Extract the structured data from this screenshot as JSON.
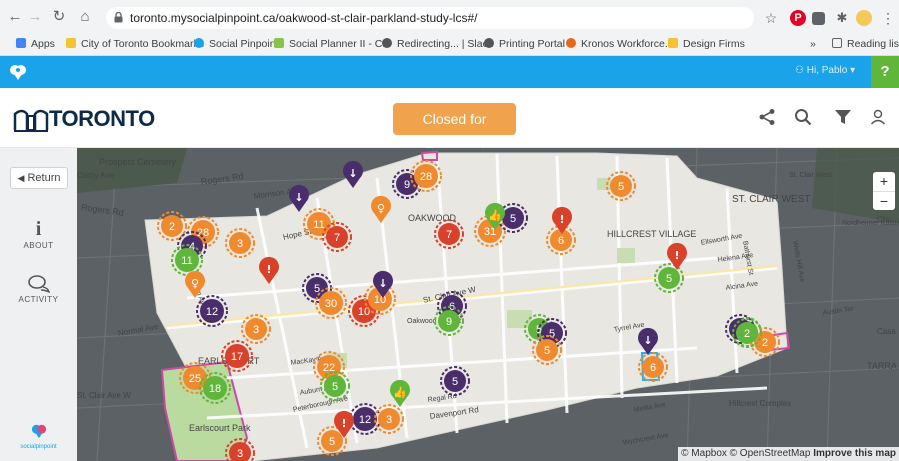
{
  "browser": {
    "url": "toronto.mysocialpinpoint.ca/oakwood-st-clair-parkland-study-lcs#/",
    "bookmarks": [
      "Apps",
      "City of Toronto Bookmarks",
      "Social Pinpoint",
      "Social Planner II - C...",
      "Redirecting... | Slack",
      "Printing Portal",
      "Kronos Workforce...",
      "Design Firms"
    ],
    "more": "»",
    "reading_list": "Reading list"
  },
  "app": {
    "user_greeting": "Hi, Pablo",
    "help": "?",
    "status_button": "Closed for Comment",
    "logo_text": "TORONTO",
    "brand_small": "socialpinpoint"
  },
  "sidebar": {
    "return_label": "Return",
    "about_label": "ABOUT",
    "activity_label": "ACTIVITY"
  },
  "map": {
    "attribution": "© Mapbox © OpenStreetMap",
    "improve": "Improve this map",
    "zoom_in": "+",
    "zoom_out": "−",
    "place_labels": [
      {
        "text": "Prospect Cemetery"
      },
      {
        "text": "Corby Ave"
      },
      {
        "text": "Rogers Rd"
      },
      {
        "text": "Morrison Ave"
      },
      {
        "text": "Rogers Rd"
      },
      {
        "text": "OAKWOOD"
      },
      {
        "text": "HILLCREST VILLAGE"
      },
      {
        "text": "ST. CLAIR WEST"
      },
      {
        "text": "St. Clair West"
      },
      {
        "text": "Nordheimer Ravine"
      },
      {
        "text": "Hope St"
      },
      {
        "text": "Ellsworth Ave"
      },
      {
        "text": "Helena Ave"
      },
      {
        "text": "Alcina Ave"
      },
      {
        "text": "Austin Ter"
      },
      {
        "text": "St. Clair Ave W"
      },
      {
        "text": "Normal Ave"
      },
      {
        "text": "EARLSCOURT"
      },
      {
        "text": "MacKay Ave"
      },
      {
        "text": "Tyrrel Ave"
      },
      {
        "text": "Hillcrest Complex"
      },
      {
        "text": "Earlscourt Park"
      },
      {
        "text": "Regal Rd"
      },
      {
        "text": "Davenport Rd"
      },
      {
        "text": "Melita Ave"
      },
      {
        "text": "Wychcrest Ave"
      },
      {
        "text": "Peterborough Ave"
      },
      {
        "text": "Auburn Ave"
      },
      {
        "text": "St. Clair Ave W"
      },
      {
        "text": "Casa"
      },
      {
        "text": "TARRA VILLA"
      },
      {
        "text": "Chu"
      },
      {
        "text": "Oakwood Regent"
      },
      {
        "text": "Gwynn Ave"
      },
      {
        "text": "Wells Hill Ave"
      },
      {
        "text": "Bathurst St"
      }
    ],
    "clusters": [
      {
        "n": "2",
        "c": "orange"
      },
      {
        "n": "28",
        "c": "orange"
      },
      {
        "n": "3",
        "c": "orange"
      },
      {
        "n": "4",
        "c": "purple"
      },
      {
        "n": "11",
        "c": "green"
      },
      {
        "n": "11",
        "c": "orange"
      },
      {
        "n": "7",
        "c": "red"
      },
      {
        "n": "9",
        "c": "purple"
      },
      {
        "n": "28",
        "c": "orange"
      },
      {
        "n": "7",
        "c": "red"
      },
      {
        "n": "31",
        "c": "orange"
      },
      {
        "n": "5",
        "c": "purple"
      },
      {
        "n": "6",
        "c": "orange"
      },
      {
        "n": "5",
        "c": "orange"
      },
      {
        "n": "5",
        "c": "purple"
      },
      {
        "n": "30",
        "c": "orange"
      },
      {
        "n": "10",
        "c": "red"
      },
      {
        "n": "10",
        "c": "orange"
      },
      {
        "n": "12",
        "c": "purple"
      },
      {
        "n": "3",
        "c": "orange"
      },
      {
        "n": "6",
        "c": "purple"
      },
      {
        "n": "9",
        "c": "green"
      },
      {
        "n": "5",
        "c": "green"
      },
      {
        "n": "5",
        "c": "purple"
      },
      {
        "n": "5",
        "c": "orange"
      },
      {
        "n": "5",
        "c": "green"
      },
      {
        "n": "17",
        "c": "red"
      },
      {
        "n": "22",
        "c": "orange"
      },
      {
        "n": "5",
        "c": "green"
      },
      {
        "n": "25",
        "c": "orange"
      },
      {
        "n": "18",
        "c": "green"
      },
      {
        "n": "5",
        "c": "purple"
      },
      {
        "n": "12",
        "c": "purple"
      },
      {
        "n": "3",
        "c": "orange"
      },
      {
        "n": "5",
        "c": "orange"
      },
      {
        "n": "3",
        "c": "red"
      },
      {
        "n": "6",
        "c": "orange"
      },
      {
        "n": "2",
        "c": "green"
      },
      {
        "n": "2",
        "c": "orange"
      },
      {
        "n": "4",
        "c": "purple"
      },
      {
        "n": "2",
        "c": "green"
      }
    ],
    "marker_colors": {
      "orange": "#f08a2e",
      "red": "#d9412b",
      "purple": "#4a2d6b",
      "green": "#5fb63a"
    }
  }
}
